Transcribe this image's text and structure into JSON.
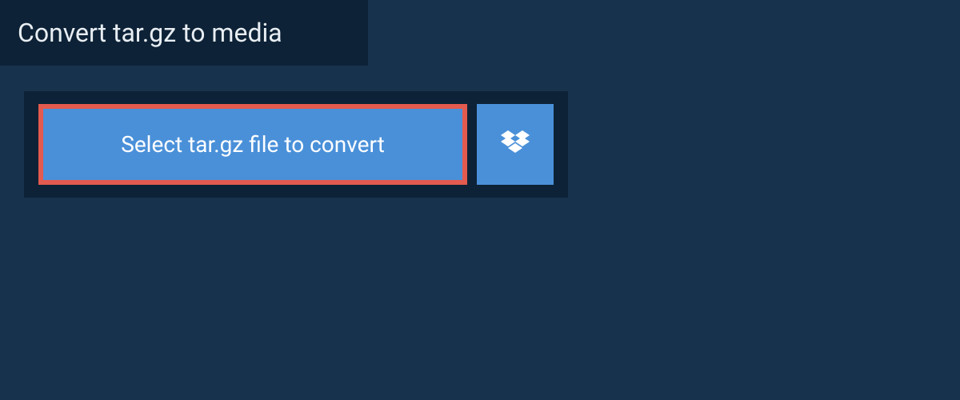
{
  "header": {
    "title": "Convert tar.gz to media"
  },
  "upload": {
    "select_label": "Select tar.gz file to convert"
  },
  "colors": {
    "bg_outer": "#17324c",
    "bg_panel": "#0d2236",
    "button_blue": "#4a90d9",
    "button_border": "#e35a4f",
    "text_light": "#e8eef3"
  }
}
